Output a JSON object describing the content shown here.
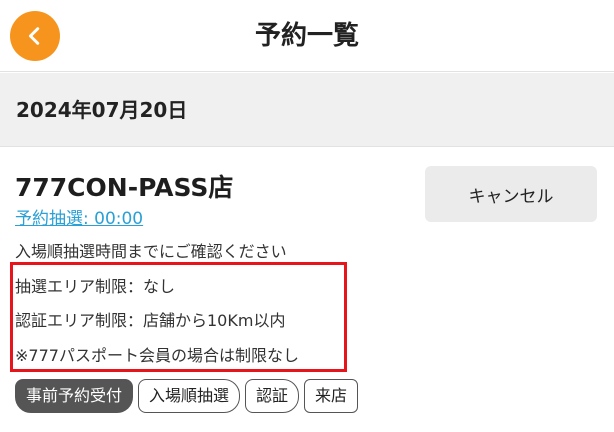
{
  "header": {
    "title": "予約一覧",
    "back_icon": "chevron-left-icon"
  },
  "date_section": {
    "date": "2024年07月20日"
  },
  "reservation": {
    "store_name": "777CON-PASS店",
    "lottery_link": "予約抽選: 00:00",
    "cancel_label": "キャンセル",
    "note": "入場順抽選時間までにご確認ください",
    "restrictions": [
      "抽選エリア制限：なし",
      "認証エリア制限：店舗から10Km以内",
      "※777パスポート会員の場合は制限なし"
    ],
    "tags": [
      "事前予約受付",
      "入場順抽選",
      "認証",
      "来店"
    ]
  },
  "colors": {
    "accent": "#f7941d",
    "link": "#2aa0d6",
    "highlight": "#e8141b",
    "tag_filled": "#555555"
  }
}
